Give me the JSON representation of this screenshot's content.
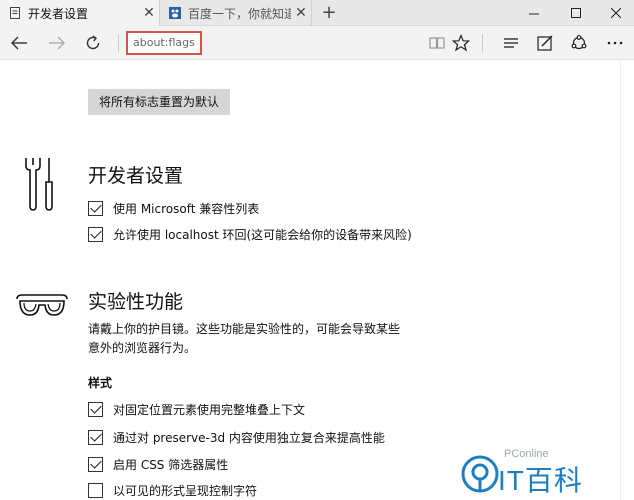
{
  "tabs": [
    {
      "title": "开发者设置",
      "active": true
    },
    {
      "title": "百度一下，你就知道",
      "active": false
    }
  ],
  "address": {
    "value": "about:flags"
  },
  "content": {
    "reset_button": "将所有标志重置为默认",
    "developer": {
      "title": "开发者设置",
      "options": [
        {
          "label": "使用 Microsoft 兼容性列表",
          "checked": true
        },
        {
          "label": "允许使用 localhost 环回(这可能会给你的设备带来风险)",
          "checked": true
        }
      ]
    },
    "experimental": {
      "title": "实验性功能",
      "description_line1": "请戴上你的护目镜。这些功能是实验性的，可能会导致某些",
      "description_line2": "意外的浏览器行为。",
      "style_heading": "样式",
      "options": [
        {
          "label": "对固定位置元素使用完整堆叠上下文",
          "checked": true
        },
        {
          "label": "通过对 preserve-3d 内容使用独立复合来提高性能",
          "checked": true
        },
        {
          "label": "启用 CSS 筛选器属性",
          "checked": true
        },
        {
          "label": "以可见的形式呈现控制字符",
          "checked": false
        }
      ]
    }
  },
  "watermark": {
    "small": "PConline",
    "big": "IT百科"
  },
  "colors": {
    "accent": "#1c7fc0",
    "address_highlight": "#d9534f"
  }
}
